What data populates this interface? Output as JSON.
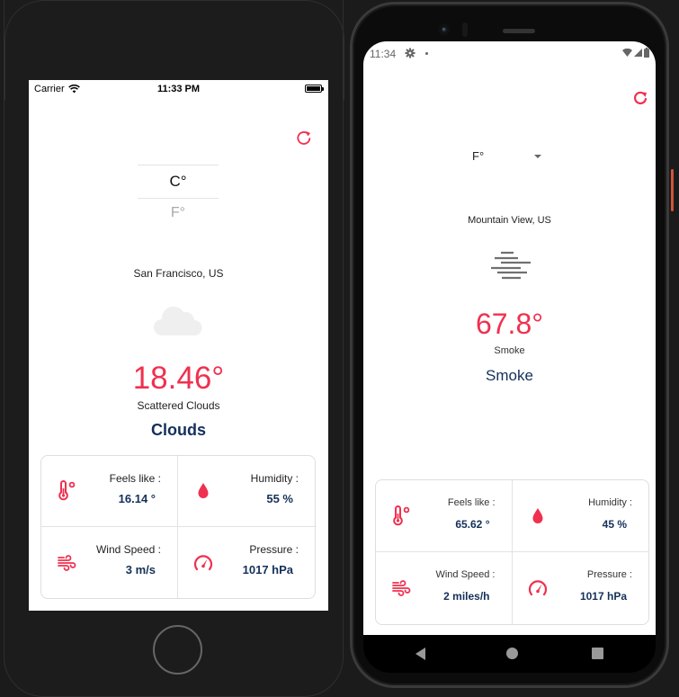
{
  "ios": {
    "status": {
      "carrier": "Carrier",
      "time": "11:33 PM"
    },
    "unit_picker": {
      "options": [
        "C°",
        "F°"
      ],
      "selected": "C°"
    },
    "city": "San Francisco, US",
    "weather_icon": "cloud-icon",
    "temperature": "18.46°",
    "description": "Scattered Clouds",
    "main": "Clouds",
    "details": [
      {
        "icon": "thermometer-icon",
        "label": "Feels like :",
        "value": "16.14 °"
      },
      {
        "icon": "humidity-drop-icon",
        "label": "Humidity :",
        "value": "55 %"
      },
      {
        "icon": "wind-icon",
        "label": "Wind Speed :",
        "value": "3 m/s"
      },
      {
        "icon": "pressure-gauge-icon",
        "label": "Pressure :",
        "value": "1017 hPa"
      }
    ]
  },
  "android": {
    "status": {
      "time": "11:34"
    },
    "unit_dropdown": {
      "selected": "F°"
    },
    "city": "Mountain View, US",
    "weather_icon": "mist-icon",
    "temperature": "67.8°",
    "description": "Smoke",
    "main": "Smoke",
    "details": [
      {
        "icon": "thermometer-icon",
        "label": "Feels like :",
        "value": "65.62 °"
      },
      {
        "icon": "humidity-drop-icon",
        "label": "Humidity :",
        "value": "45 %"
      },
      {
        "icon": "wind-icon",
        "label": "Wind Speed :",
        "value": "2 miles/h"
      },
      {
        "icon": "pressure-gauge-icon",
        "label": "Pressure :",
        "value": "1017 hPa"
      }
    ]
  },
  "colors": {
    "accent": "#f0304f",
    "primary_text": "#14305a"
  }
}
